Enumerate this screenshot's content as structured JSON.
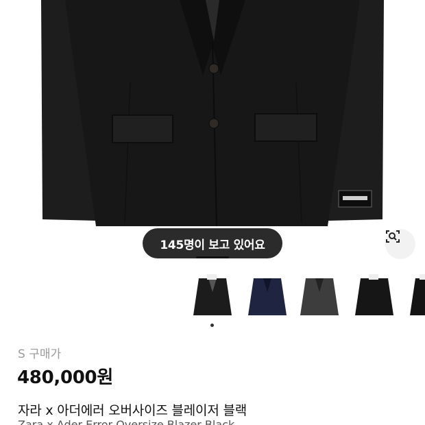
{
  "product_image": {
    "alt_icon": "jacket-photo"
  },
  "viewers_badge": {
    "text": "145명이 보고 있어요"
  },
  "lens_button": {
    "icon": "image-search-icon"
  },
  "thumbnails": [
    {
      "color": "#1c1c1c",
      "variant": "black"
    },
    {
      "color": "#1f2540",
      "variant": "navy"
    },
    {
      "color": "#3d3d3d",
      "variant": "charcoal"
    },
    {
      "color": "#161616",
      "variant": "black-2"
    },
    {
      "color": "#141414",
      "variant": "black-3"
    }
  ],
  "price": {
    "label": "S 구매가",
    "value": "480,000원"
  },
  "product": {
    "title": "자라 x 아더에러 오버사이즈 블레이저 블랙",
    "subtitle": "Zara x Ader Error Oversize Blazer Black"
  }
}
